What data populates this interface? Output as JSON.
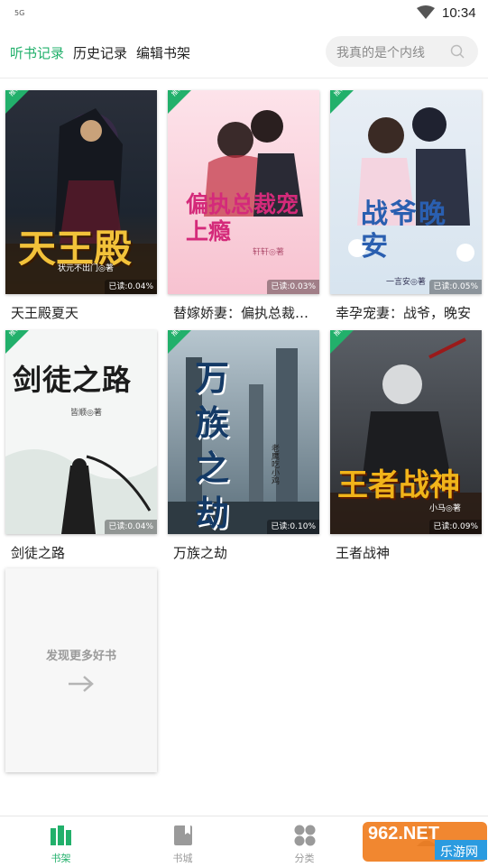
{
  "status_bar": {
    "signal": "5G",
    "time": "10:34"
  },
  "header": {
    "tabs": [
      {
        "label": "听书记录",
        "active": true
      },
      {
        "label": "历史记录",
        "active": false
      },
      {
        "label": "编辑书架",
        "active": false
      }
    ],
    "search": {
      "placeholder": "我真的是个内线"
    }
  },
  "books": [
    {
      "title": "天王殿夏天",
      "cover_title": "天王殿",
      "cover_author": "状元不出门◎著",
      "tag": "推荐",
      "progress": "已读:0.04%"
    },
    {
      "title": "替嫁娇妻：偏执总裁宠上瘾",
      "cover_title": "偏执总裁宠上瘾",
      "cover_author": "轩轩◎著",
      "tag": "推荐",
      "progress": "已读:0.03%"
    },
    {
      "title": "幸孕宠妻：战爷，晚安",
      "cover_title": "战爷晚安",
      "cover_author": "一言安◎著",
      "tag": "推荐",
      "progress": "已读:0.05%"
    },
    {
      "title": "剑徒之路",
      "cover_title": "剑徒之路",
      "cover_author": "皆顺◎著",
      "tag": "推荐",
      "progress": "已读:0.04%"
    },
    {
      "title": "万族之劫",
      "cover_title": "万族之劫",
      "cover_author": "老鹰吃小鸡",
      "tag": "推荐",
      "progress": "已读:0.10%"
    },
    {
      "title": "王者战神",
      "cover_title": "王者战神",
      "cover_author": "小马◎著",
      "tag": "推荐",
      "progress": "已读:0.09%"
    }
  ],
  "discover": {
    "label": "发现更多好书"
  },
  "bottom_nav": [
    {
      "label": "书架",
      "icon": "bookshelf-icon",
      "active": true
    },
    {
      "label": "书城",
      "icon": "book-store-icon",
      "active": false
    },
    {
      "label": "分类",
      "icon": "category-icon",
      "active": false
    },
    {
      "label": "",
      "icon": "profile-icon",
      "active": false
    }
  ],
  "watermark": {
    "text": "962.NET",
    "subtext": "乐游网"
  },
  "colors": {
    "accent": "#22b06b",
    "text": "#222222",
    "muted": "#9a9a9a"
  }
}
